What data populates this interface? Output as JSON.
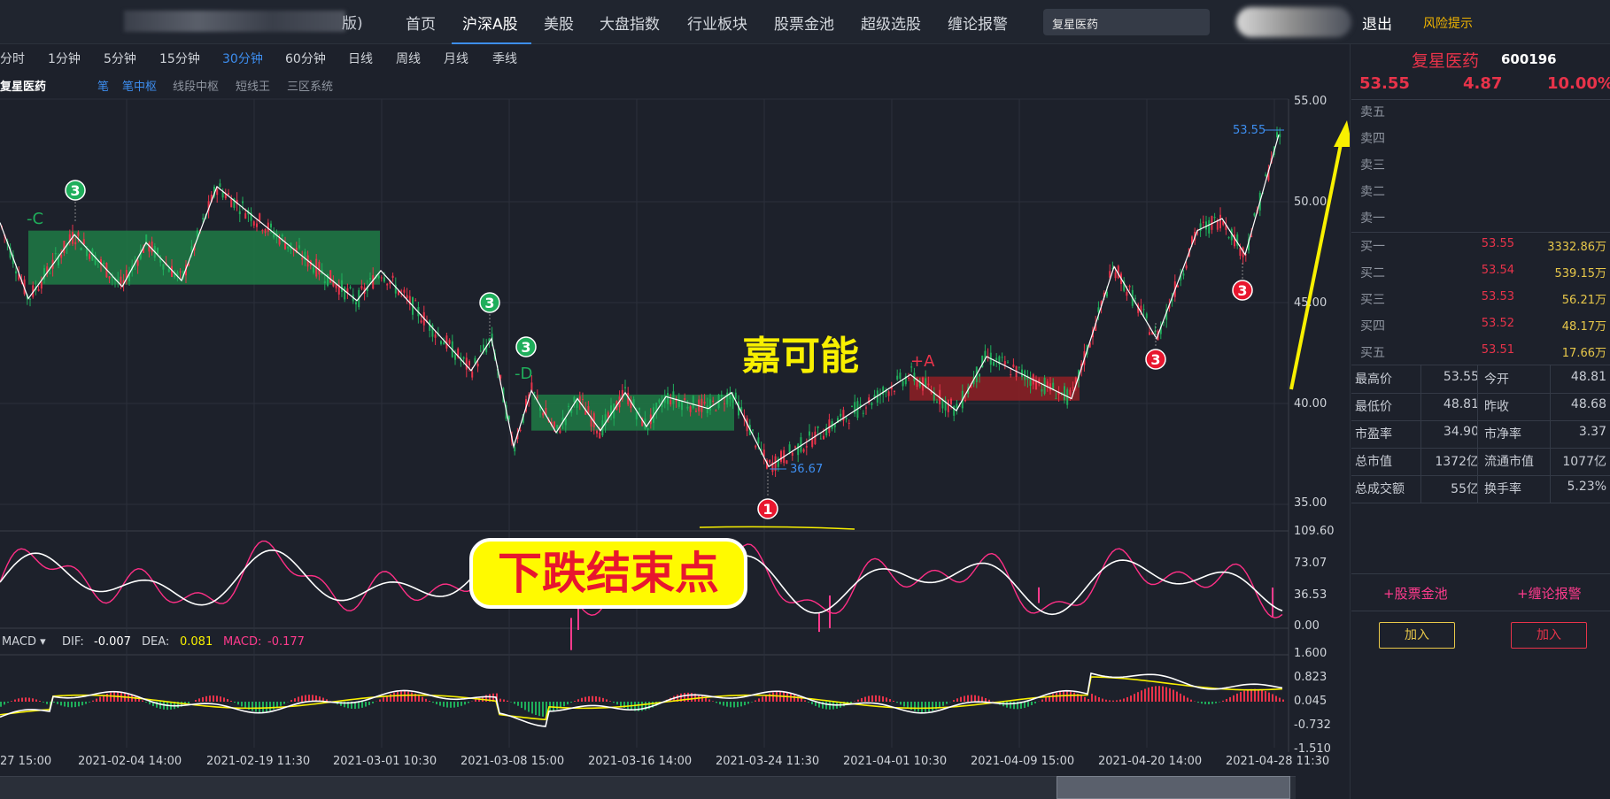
{
  "nav": {
    "logo_suffix": "版)",
    "items": [
      "首页",
      "沪深A股",
      "美股",
      "大盘指数",
      "行业板块",
      "股票金池",
      "超级选股",
      "缠论报警"
    ],
    "active": "沪深A股",
    "search_value": "复星医药",
    "logout": "退出",
    "risk": "风险提示"
  },
  "periods": [
    "分时",
    "1分钟",
    "5分钟",
    "15分钟",
    "30分钟",
    "60分钟",
    "日线",
    "周线",
    "月线",
    "季线"
  ],
  "selected_period": "30分钟",
  "chart_header": {
    "stock_name": "复星医药",
    "subtabs": [
      "笔",
      "笔中枢",
      "线段中枢",
      "短线王",
      "三区系统"
    ]
  },
  "price_axis": [
    "55.00",
    "50.00",
    "45.00",
    "40.00",
    "35.00"
  ],
  "kdj_axis": [
    "109.60",
    "73.07",
    "36.53",
    "0.00"
  ],
  "macd_axis": [
    "1.600",
    "0.823",
    "0.045",
    "-0.732",
    "-1.510"
  ],
  "dates": [
    "27 15:00",
    "2021-02-04 14:00",
    "2021-02-19 11:30",
    "2021-03-01 10:30",
    "2021-03-08 15:00",
    "2021-03-16 14:00",
    "2021-03-24 11:30",
    "2021-04-01 10:30",
    "2021-04-09 15:00",
    "2021-04-20 14:00",
    "2021-04-28 11:30"
  ],
  "macd_legend": {
    "name": "MACD",
    "dif_label": "DIF:",
    "dif_value": "-0.007",
    "dea_label": "DEA:",
    "dea_value": "0.081",
    "macd_label": "MACD:",
    "macd_value": "-0.177"
  },
  "annotations": {
    "high_price": "53.55",
    "low_price": "36.67",
    "label_c": "-C",
    "label_d": "-D",
    "label_a": "+A",
    "callout_down_end": "下跌结束点",
    "callout_jia": "嘉可能",
    "marker_1": "1",
    "marker_3": "3"
  },
  "panel": {
    "name": "复星医药",
    "code": "600196",
    "price": "53.55",
    "change": "4.87",
    "change_pct": "10.00%",
    "asks": [
      {
        "label": "卖五",
        "price": "",
        "vol": ""
      },
      {
        "label": "卖四",
        "price": "",
        "vol": ""
      },
      {
        "label": "卖三",
        "price": "",
        "vol": ""
      },
      {
        "label": "卖二",
        "price": "",
        "vol": ""
      },
      {
        "label": "卖一",
        "price": "",
        "vol": ""
      }
    ],
    "bids": [
      {
        "label": "买一",
        "price": "53.55",
        "vol": "3332.86万"
      },
      {
        "label": "买二",
        "price": "53.54",
        "vol": "539.15万"
      },
      {
        "label": "买三",
        "price": "53.53",
        "vol": "56.21万"
      },
      {
        "label": "买四",
        "price": "53.52",
        "vol": "48.17万"
      },
      {
        "label": "买五",
        "price": "53.51",
        "vol": "17.66万"
      }
    ],
    "stats": [
      [
        "最高价",
        "53.55",
        "今开",
        "48.81"
      ],
      [
        "最低价",
        "48.81",
        "昨收",
        "48.68"
      ],
      [
        "市盈率",
        "34.90",
        "市净率",
        "3.37"
      ],
      [
        "总市值",
        "1372亿",
        "流通市值",
        "1077亿"
      ],
      [
        "总成交额",
        "55亿",
        "换手率",
        "5.23%"
      ]
    ],
    "pool_tab": "+股票金池",
    "alert_tab": "+缠论报警",
    "add_label": "加入"
  },
  "colors": {
    "up": "#e8334a",
    "down": "#1fae5b",
    "accent": "#3d8ef0",
    "zone_green": "#1f7a45",
    "zone_red": "#8f1f25",
    "yellow": "#f8f000"
  }
}
